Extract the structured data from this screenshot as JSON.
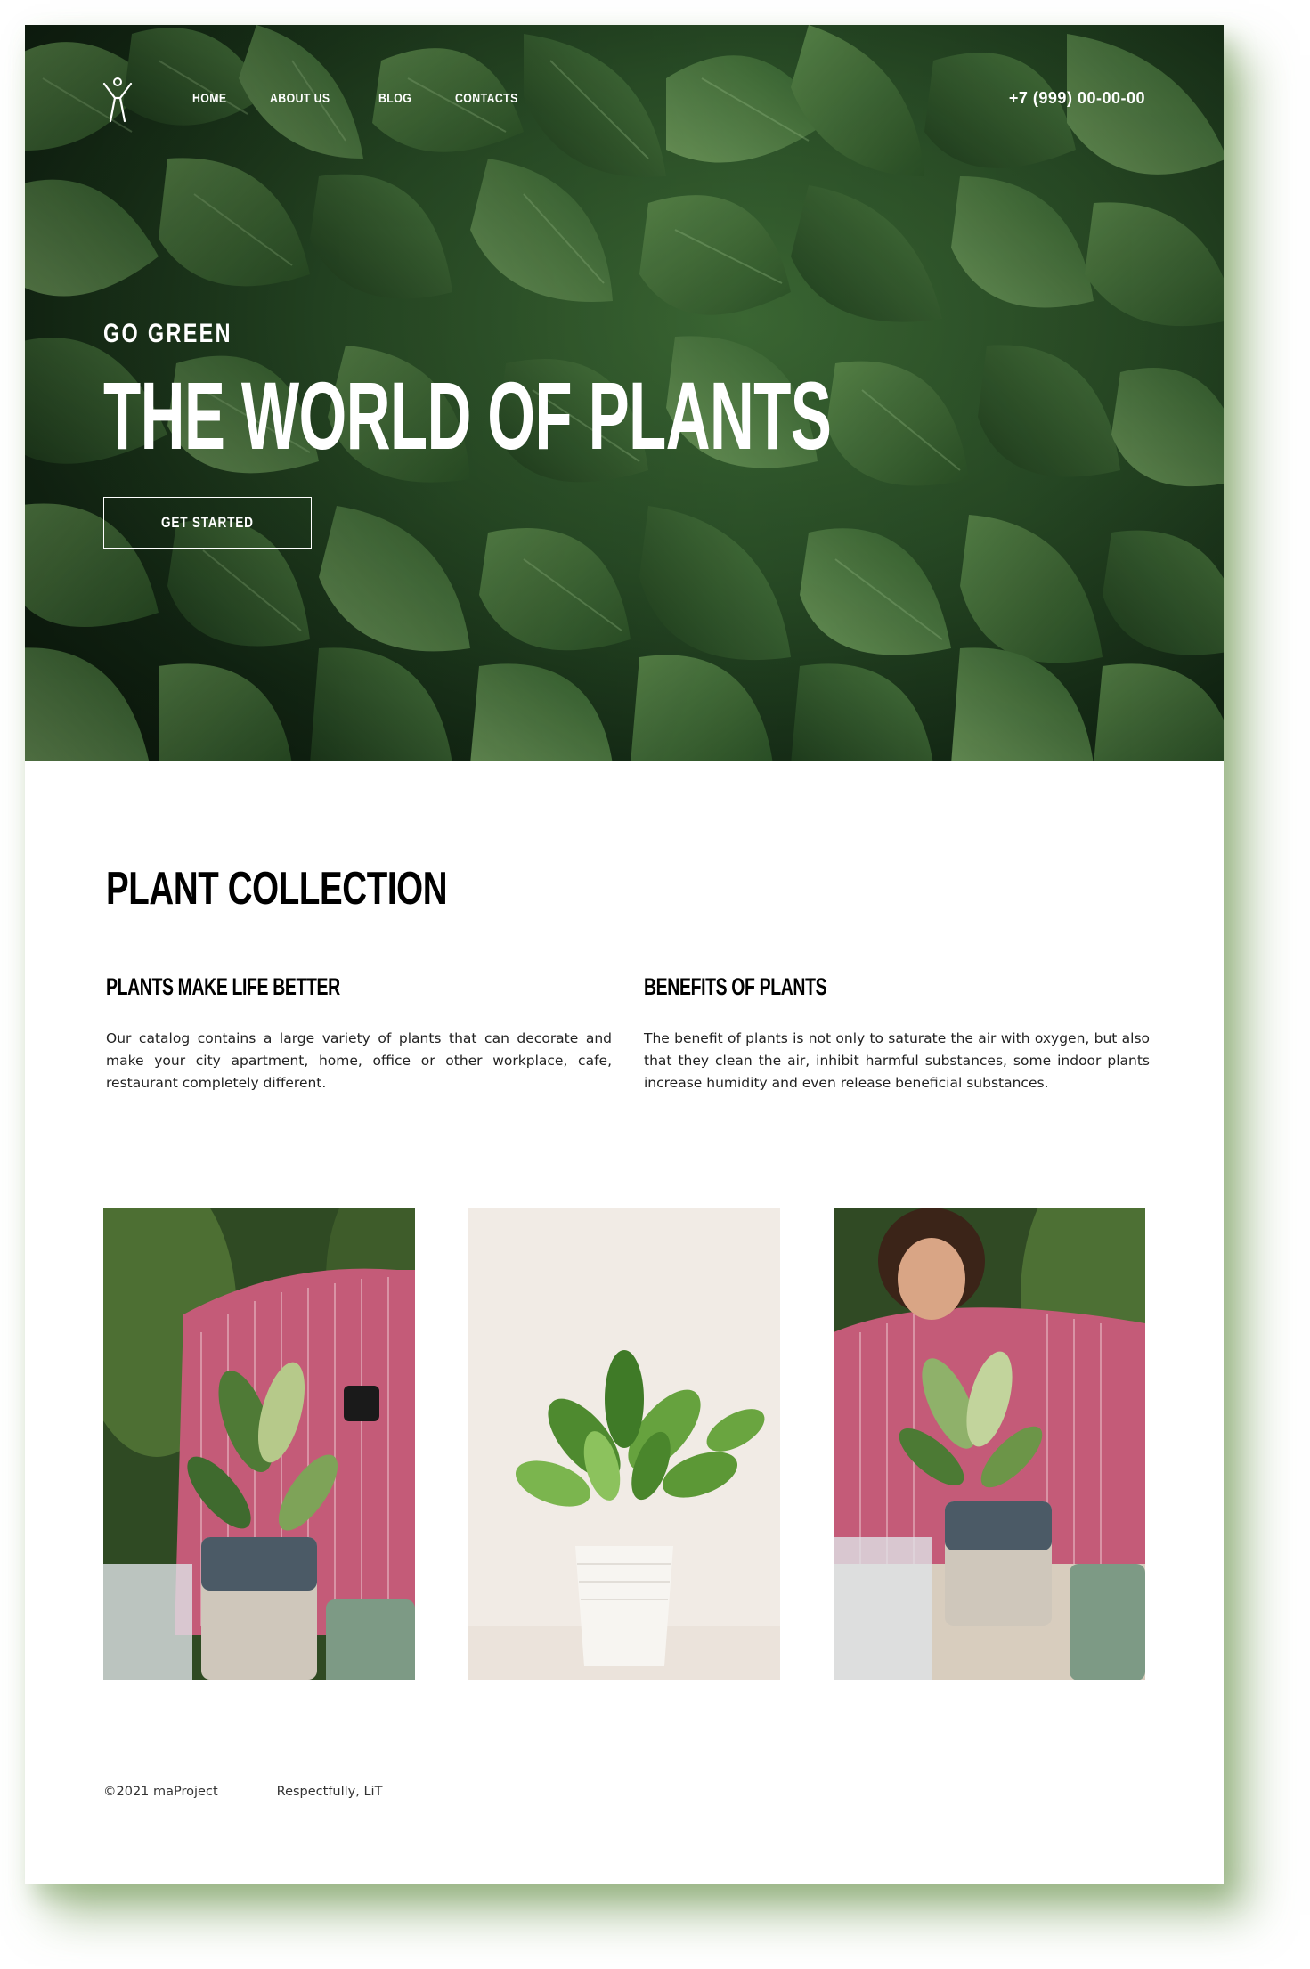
{
  "header": {
    "logo_icon": "person-arms-raised-icon",
    "nav": [
      {
        "label": "HOME"
      },
      {
        "label": "ABOUT US"
      },
      {
        "label": "BLOG"
      },
      {
        "label": "CONTACTS"
      }
    ],
    "phone": "+7 (999) 00-00-00"
  },
  "hero": {
    "eyebrow": "GO GREEN",
    "title": "THE WORLD OF PLANTS",
    "cta_label": "GET STARTED",
    "background": "dense-green-leaves-photo"
  },
  "collection": {
    "title": "PLANT COLLECTION",
    "columns": [
      {
        "heading": "PLANTS MAKE LIFE BETTER",
        "text": "Our catalog contains a large variety of plants that can decorate and make your city apartment, home, office or other workplace, cafe, restaurant completely different."
      },
      {
        "heading": "BENEFITS OF PLANTS",
        "text": "The benefit of plants is not only to saturate the air with oxygen, but also that they clean the air, inhibit harmful substances, some indoor plants increase humidity and even release beneficial substances."
      }
    ]
  },
  "gallery": [
    {
      "image": "woman-spraying-potted-plant-photo"
    },
    {
      "image": "white-pot-plant-photo"
    },
    {
      "image": "smiling-woman-potting-plant-photo"
    }
  ],
  "footer": {
    "copyright": "©2021 maProject",
    "credit": "Respectfully, LiT"
  },
  "colors": {
    "shadow_green": "#6e9650",
    "leaf_dark": "#142a15",
    "leaf_mid": "#3d6b35",
    "text_black": "#000000"
  }
}
